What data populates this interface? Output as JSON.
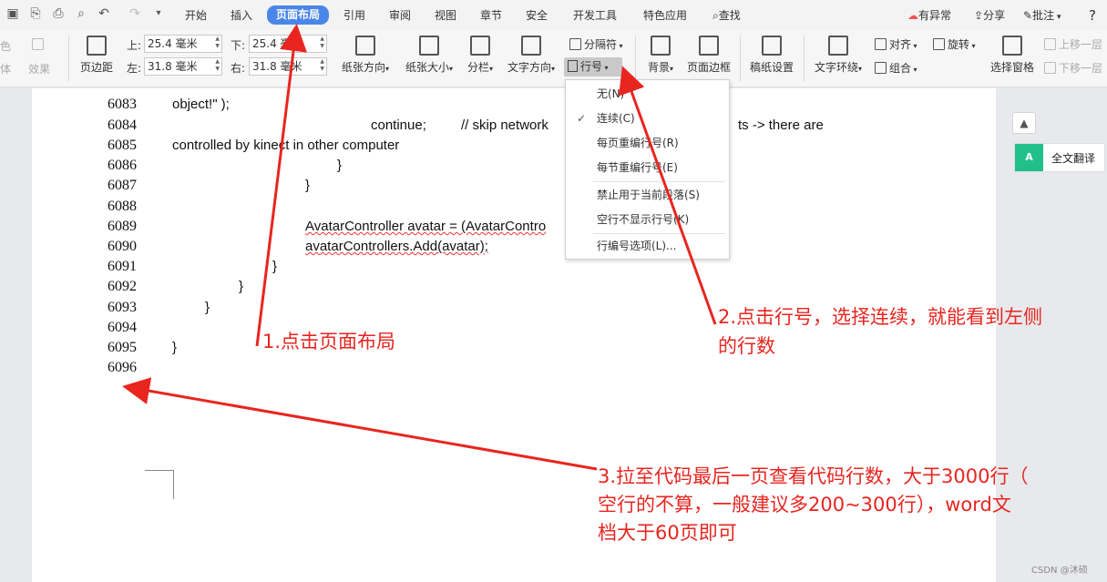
{
  "menubar": {
    "tabs": [
      "开始",
      "插入",
      "页面布局",
      "引用",
      "审阅",
      "视图",
      "章节",
      "安全",
      "开发工具",
      "特色应用"
    ],
    "active_tab": "页面布局",
    "search_label": "查找",
    "right_items": [
      "有异常",
      "分享",
      "批注",
      "?"
    ]
  },
  "ribbon": {
    "left_clipped": [
      "色",
      "体",
      "效果"
    ],
    "margins_label": "页边距",
    "margin_top_label": "上:",
    "margin_top_value": "25.4 毫米",
    "margin_bottom_label": "下:",
    "margin_bottom_value": "25.4 毫米",
    "margin_left_label": "左:",
    "margin_left_value": "31.8 毫米",
    "margin_right_label": "右:",
    "margin_right_value": "31.8 毫米",
    "orientation": "纸张方向",
    "paper_size": "纸张大小",
    "columns": "分栏",
    "text_direction": "文字方向",
    "separator": "分隔符",
    "line_number": "行号",
    "background": "背景",
    "page_border": "页面边框",
    "grid_paper": "稿纸设置",
    "text_wrap": "文字环绕",
    "align": "对齐",
    "rotate": "旋转",
    "group": "组合",
    "select_pane": "选择窗格",
    "bring_forward": "上移一层",
    "send_backward": "下移一层"
  },
  "dropdown": {
    "items": [
      "无(N)",
      "连续(C)",
      "每页重编行号(R)",
      "每节重编行号(E)",
      "禁止用于当前段落(S)",
      "空行不显示行号(K)",
      "行编号选项(L)..."
    ],
    "checked": "连续(C)"
  },
  "document": {
    "line_numbers": [
      "6083",
      "6084",
      "6085",
      "6086",
      "6087",
      "6088",
      "6089",
      "6090",
      "6091",
      "6092",
      "6093",
      "6094",
      "6095",
      "6096"
    ],
    "code_lines": [
      "object!\" );",
      "continue;",
      "// skip network",
      "ts -> there are",
      "controlled by kinect in other computer",
      "}",
      "}",
      "AvatarController avatar = (AvatarContro",
      "avatarControllers.Add(avatar);",
      "}",
      "}",
      "}",
      "}"
    ]
  },
  "right_panel": {
    "collapse_icon": "▲",
    "translate_icon_text": "A",
    "translate_label": "全文翻译"
  },
  "annotations": {
    "step1": "1.点击页面布局",
    "step2_line1": "2.点击行号，选择连续，就能看到左侧",
    "step2_line2": "的行数",
    "step3_line1": "3.拉至代码最后一页查看代码行数，大于3000行（",
    "step3_line2": "空行的不算，一般建议多200~300行），word文",
    "step3_line3": "档大于60页即可",
    "color": "#e8251f"
  },
  "watermark": "CSDN @沐硕"
}
